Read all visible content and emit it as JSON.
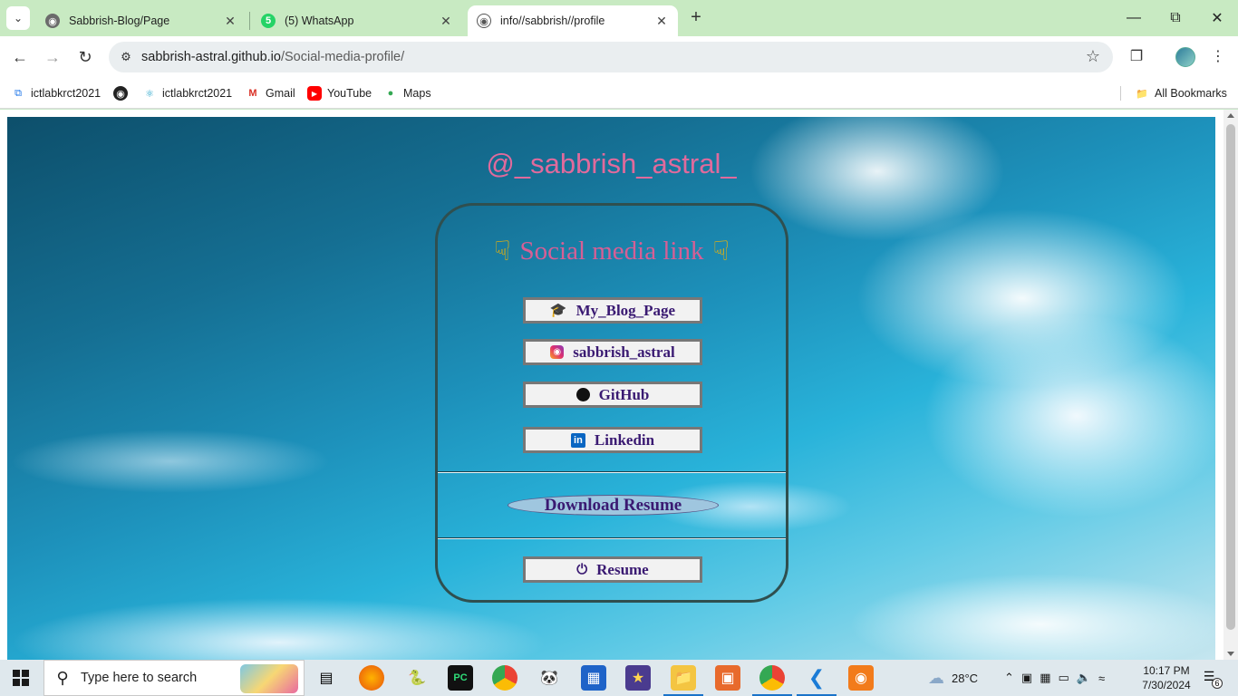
{
  "browser": {
    "tabs": [
      {
        "title": "Sabbrish-Blog/Page",
        "favicon": "globe-icon"
      },
      {
        "title": "(5) WhatsApp",
        "favicon": "whatsapp-icon"
      },
      {
        "title": "info//sabbrish//profile",
        "favicon": "globe-icon",
        "active": true
      }
    ],
    "address": {
      "host": "sabbrish-astral.github.io",
      "path": "/Social-media-profile/"
    },
    "bookmarks": [
      {
        "label": "ictlabkrct2021",
        "icon": "link-icon"
      },
      {
        "label": "",
        "icon": "globe-icon"
      },
      {
        "label": "ictlabkrct2021",
        "icon": "react-icon"
      },
      {
        "label": "Gmail",
        "icon": "gmail-icon"
      },
      {
        "label": "YouTube",
        "icon": "youtube-icon"
      },
      {
        "label": "Maps",
        "icon": "maps-icon"
      }
    ],
    "all_bookmarks": "All Bookmarks"
  },
  "page": {
    "handle": "@_sabbrish_astral_",
    "section_title": "Social media link",
    "links": [
      {
        "label": "My_Blog_Page",
        "icon": "student-icon"
      },
      {
        "label": "sabbrish_astral",
        "icon": "instagram-icon"
      },
      {
        "label": "GitHub",
        "icon": "github-icon"
      },
      {
        "label": "Linkedin",
        "icon": "linkedin-icon"
      }
    ],
    "download_label": "Download Resume",
    "resume_label": "Resume",
    "colors": {
      "handle": "#e06a9c",
      "title": "#d65f95",
      "button_text": "#3a1a72"
    }
  },
  "taskbar": {
    "search_placeholder": "Type here to search",
    "weather": "28°C",
    "weather_badge": "1",
    "time": "10:17 PM",
    "date": "7/30/2024",
    "notification_count": "6"
  }
}
